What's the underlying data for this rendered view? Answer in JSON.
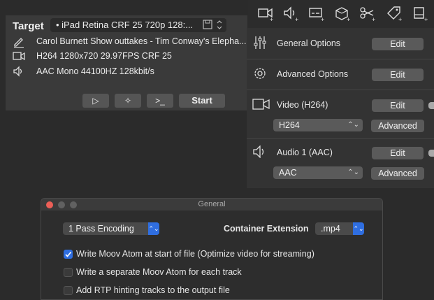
{
  "toolbar": {
    "icons": [
      "add-video-icon",
      "add-audio-icon",
      "add-subtitle-icon",
      "add-package-icon",
      "add-cut-icon",
      "add-tag-icon",
      "add-chapter-icon"
    ]
  },
  "target": {
    "title": "Target",
    "preset": "• iPad Retina CRF 25 720p 128:...",
    "name": "Carol Burnett Show outtakes - Tim Conway's Elepha...",
    "video_info": "H264 1280x720 29.97FPS CRF 25",
    "audio_info": "AAC Mono 44100HZ 128kbit/s",
    "play_label": "▷",
    "magic_label": "✧",
    "terminal_label": ">_",
    "start_label": "Start"
  },
  "options": {
    "general_label": "General Options",
    "advanced_label": "Advanced Options",
    "video_label": "Video (H264)",
    "audio_label": "Audio 1 (AAC)",
    "edit_label": "Edit",
    "advanced_btn_label": "Advanced",
    "video_codec": "H264",
    "audio_codec": "AAC"
  },
  "general_window": {
    "title": "General",
    "encoding": "1 Pass Encoding",
    "container_label": "Container Extension",
    "container_value": ".mp4",
    "checkboxes": [
      {
        "label": "Write Moov Atom at start of file (Optimize video for streaming)",
        "checked": true
      },
      {
        "label": "Write a separate Moov Atom for each track",
        "checked": false
      },
      {
        "label": "Add RTP hinting tracks to the output file",
        "checked": false
      }
    ]
  },
  "colors": {
    "accent": "#2f6ee0",
    "close": "#ec5f57"
  }
}
